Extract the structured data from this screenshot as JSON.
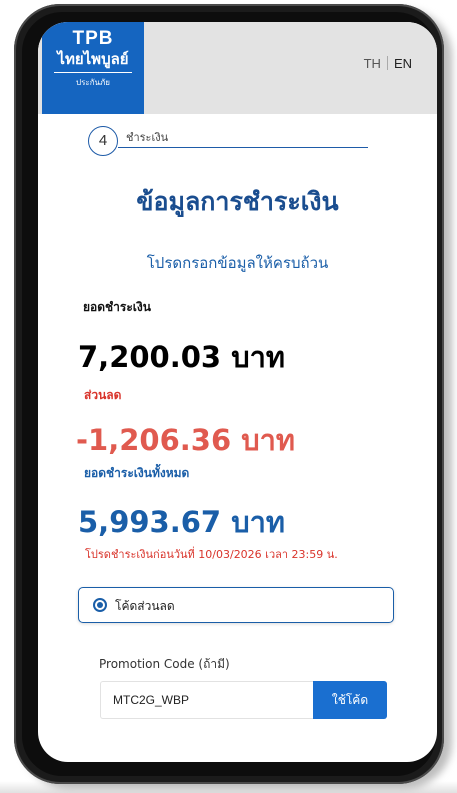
{
  "header": {
    "logo": {
      "brand": "TPB",
      "name_thai": "ไทยไพบูลย์",
      "sub_thai": "ประกันภัย"
    },
    "lang": {
      "th": "TH",
      "en": "EN",
      "active": "EN"
    }
  },
  "step": {
    "number": "4",
    "label": "ชำระเงิน"
  },
  "main": {
    "title": "ข้อมูลการชำระเงิน",
    "subtitle": "โปรดกรอกข้อมูลให้ครบถ้วน",
    "total_label": "ยอดชำระเงิน",
    "total_amount": "7,200.03 บาท",
    "discount_label": "ส่วนลด",
    "discount_amount": "-1,206.36 บาท",
    "net_label": "ยอดชำระเงินทั้งหมด",
    "net_amount": "5,993.67 บาท",
    "deadline_note": "โปรดชำระเงินก่อนวันที่ 10/03/2026 เวลา 23:59 น."
  },
  "discount_option": {
    "label": "โค้ดส่วนลด",
    "selected": true
  },
  "promo": {
    "label": "Promotion Code (ถ้ามี)",
    "value": "MTC2G_WBP",
    "button_label": "ใช้โค้ด"
  },
  "colors": {
    "brand_blue": "#1565c0",
    "title_blue": "#1a4d8f",
    "net_blue": "#1a5ea8",
    "discount_red": "#e05a4f",
    "note_red": "#d9342b",
    "button_blue": "#1a6fd0"
  }
}
